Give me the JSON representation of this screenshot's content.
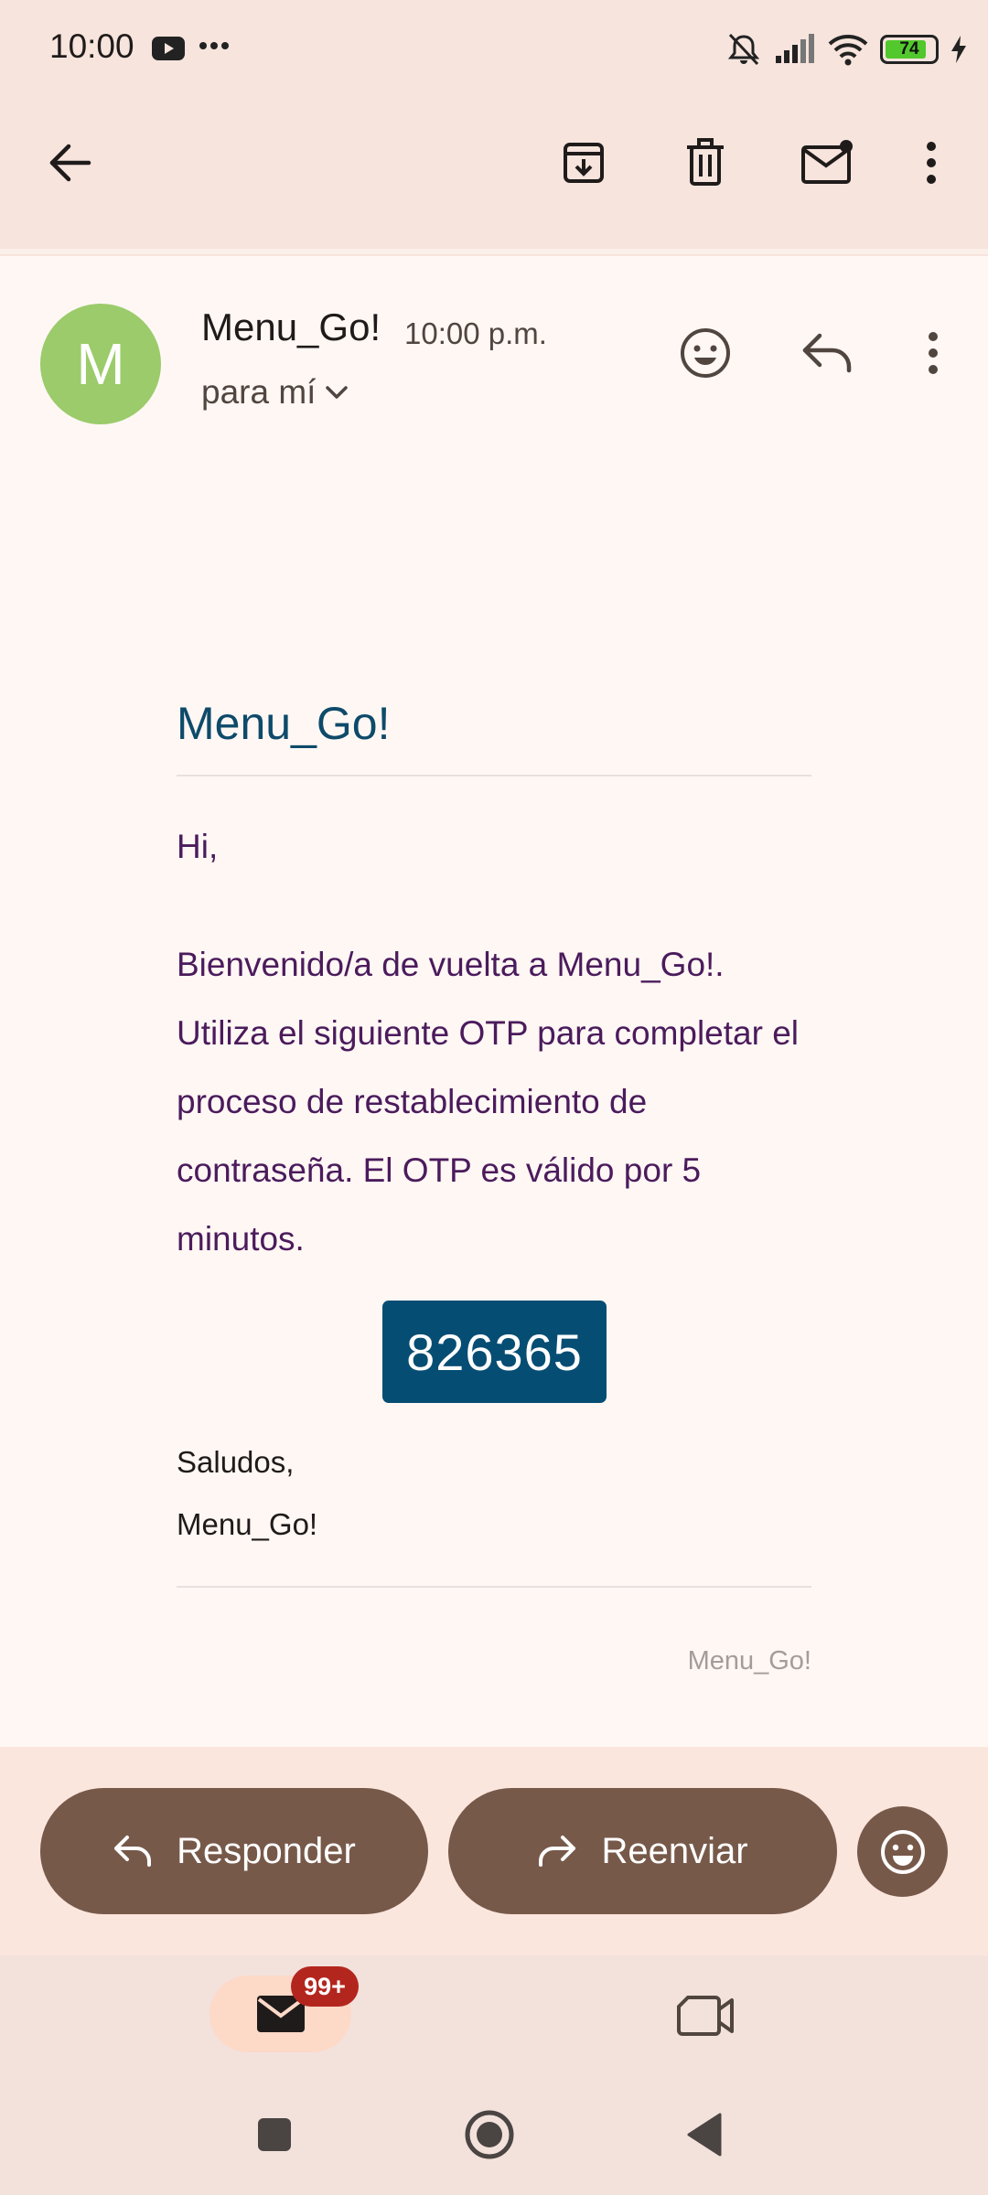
{
  "status_bar": {
    "time": "10:00",
    "battery_level": "74",
    "icons": [
      "youtube-icon",
      "more-notifications-icon",
      "muted-icon",
      "signal-icon",
      "wifi-icon",
      "battery-icon",
      "charging-icon"
    ]
  },
  "app_bar": {
    "icons": [
      "back-arrow-icon",
      "archive-icon",
      "delete-icon",
      "mark-unread-icon",
      "more-vert-icon"
    ]
  },
  "email": {
    "avatar_letter": "M",
    "sender": "Menu_Go!",
    "time": "10:00 p.m.",
    "recipient": "para mí",
    "header_icons": [
      "add-reaction-icon",
      "reply-icon",
      "more-vert-icon"
    ]
  },
  "body": {
    "brand_title": "Menu_Go!",
    "greeting": "Hi,",
    "message": "Bienvenido/a de vuelta a Menu_Go!. Utiliza el siguiente OTP para completar el proceso de restablecimiento de contraseña. El OTP es válido por 5 minutos.",
    "otp": "826365",
    "signoff": "Saludos,",
    "signature": "Menu_Go!",
    "footer": "Menu_Go!"
  },
  "actions": {
    "reply_label": "Responder",
    "forward_label": "Reenviar"
  },
  "bottom_nav": {
    "mail_badge": "99+",
    "tabs": [
      "mail-icon",
      "meet-video-icon"
    ]
  },
  "colors": {
    "background": "#f6e4dd",
    "card": "#fff7f4",
    "accent_button": "#77594a",
    "otp_box": "#064d73",
    "brand_title": "#0e4a6a",
    "body_text": "#4b1b5c",
    "avatar": "#9bcb6a",
    "badge": "#b3261e"
  }
}
